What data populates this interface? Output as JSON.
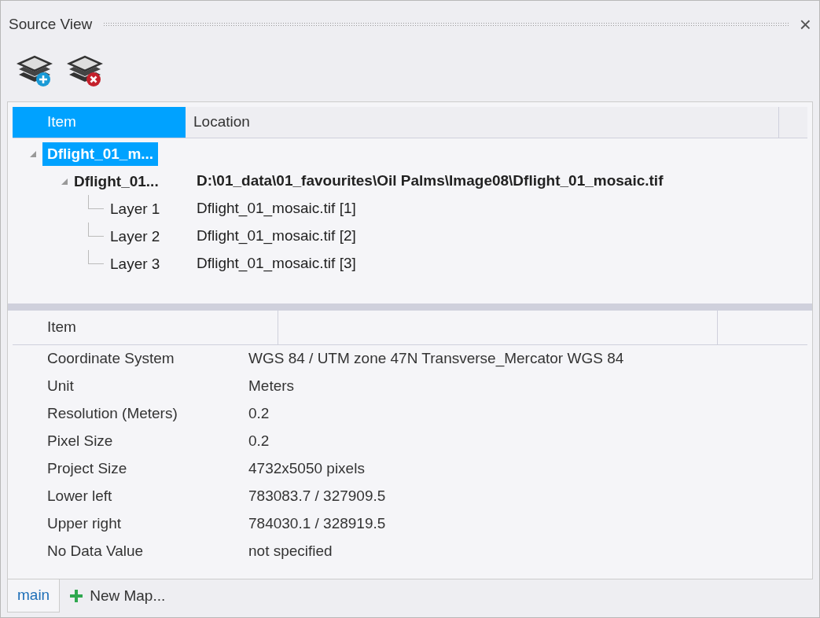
{
  "panel": {
    "title": "Source View",
    "close": "×"
  },
  "toolbar": [
    {
      "kind": "add"
    },
    {
      "kind": "remove"
    }
  ],
  "tree": {
    "columns": [
      {
        "label": "Item",
        "selected": true
      },
      {
        "label": "Location",
        "selected": false
      }
    ],
    "items": [
      {
        "label": "Dflight_01_m...",
        "selected": true,
        "expanded": true,
        "bold": true,
        "children": [
          {
            "label": "Dflight_01...",
            "location": "D:\\01_data\\01_favourites\\Oil Palms\\Image08\\Dflight_01_mosaic.tif",
            "selected": false,
            "expanded": true,
            "bold": true,
            "children": [
              {
                "label": "Layer 1",
                "location": "Dflight_01_mosaic.tif [1]",
                "selected": false,
                "bold": false
              },
              {
                "label": "Layer 2",
                "location": "Dflight_01_mosaic.tif [2]",
                "selected": false,
                "bold": false
              },
              {
                "label": "Layer 3",
                "location": "Dflight_01_mosaic.tif [3]",
                "selected": false,
                "bold": false
              }
            ]
          }
        ]
      }
    ]
  },
  "properties": {
    "columns": [
      "Item"
    ],
    "rows": [
      {
        "item": "Coordinate System",
        "value": "WGS 84 / UTM zone 47N  Transverse_Mercator  WGS 84"
      },
      {
        "item": "Unit",
        "value": "Meters"
      },
      {
        "item": "Resolution (Meters)",
        "value": "0.2"
      },
      {
        "item": "Pixel Size",
        "value": "0.2"
      },
      {
        "item": "Project Size",
        "value": "4732x5050 pixels"
      },
      {
        "item": "Lower left",
        "value": "783083.7 / 327909.5"
      },
      {
        "item": "Upper right",
        "value": "784030.1 / 328919.5"
      },
      {
        "item": "No Data Value",
        "value": "not specified"
      }
    ]
  },
  "tabs": [
    {
      "label": "main",
      "selected": true,
      "kind": "tab"
    },
    {
      "label": "New Map...",
      "selected": false,
      "kind": "new"
    }
  ]
}
